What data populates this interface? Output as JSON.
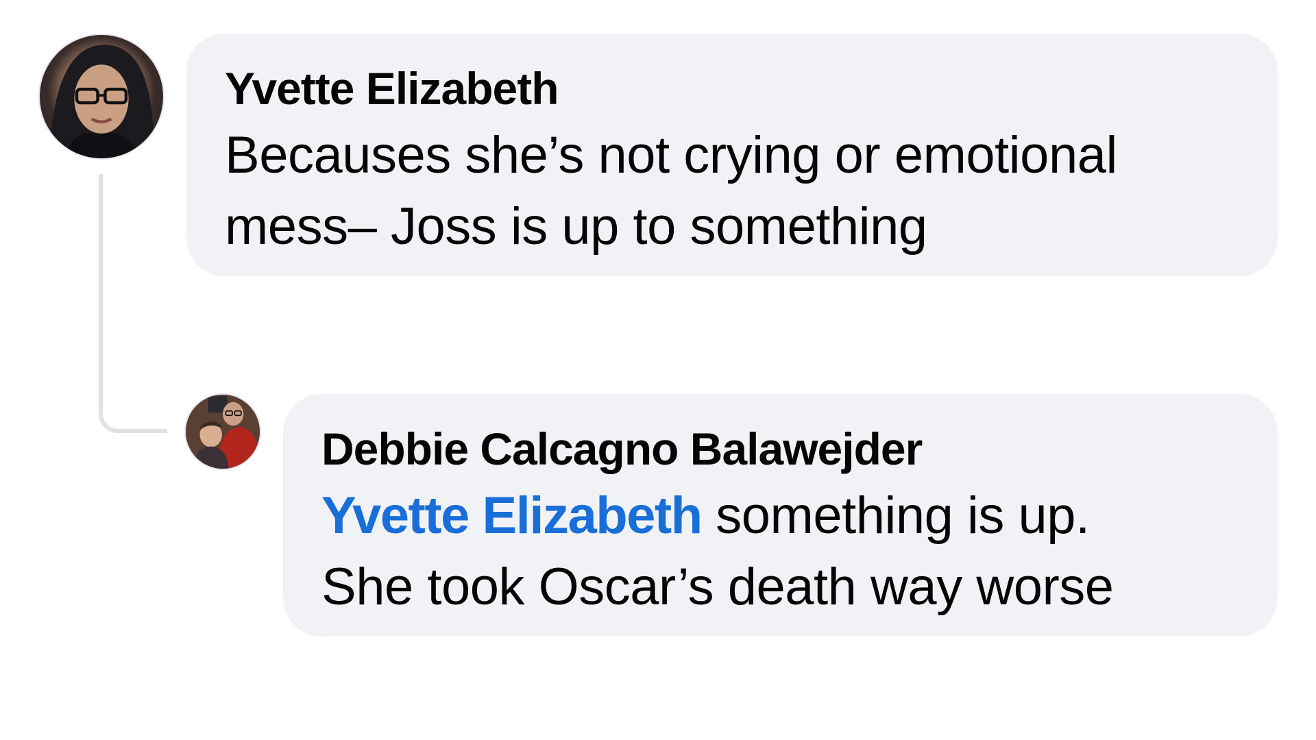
{
  "comment": {
    "author": "Yvette Elizabeth",
    "text_line1": "Becauses she’s not crying or emotional",
    "text_line2": "mess– Joss is up to something"
  },
  "reply": {
    "author": "Debbie Calcagno Balawejder",
    "mention": "Yvette Elizabeth",
    "text_line1_rest": " something is up.",
    "text_line2": "She took Oscar’s death way worse"
  },
  "colors": {
    "bubble_background": "#f0f2f5",
    "mention_link": "#1a6ed8",
    "thread_line": "#dfe1e5",
    "text": "#050505"
  }
}
